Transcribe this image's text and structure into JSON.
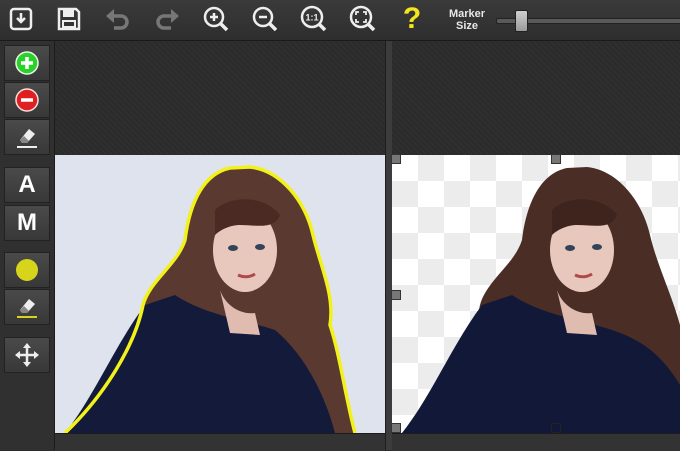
{
  "toolbar": {
    "open_icon": "download-icon",
    "save_icon": "floppy-disk-icon",
    "undo_icon": "undo-icon",
    "redo_icon": "redo-icon",
    "zoom_in_icon": "zoom-in-icon",
    "zoom_out_icon": "zoom-out-icon",
    "actual_size_label": "1:1",
    "fit_icon": "fit-screen-icon",
    "help_label": "?",
    "marker_size_line1": "Marker",
    "marker_size_line2": "Size",
    "marker_size_level": 0.12
  },
  "sidebar": {
    "add_icon": "plus-circle-icon",
    "remove_icon": "minus-circle-icon",
    "eraser_icon": "eraser-icon",
    "auto_label": "A",
    "manual_label": "M",
    "color_icon": "yellow-dot-icon",
    "eraser2_icon": "eraser-icon",
    "move_icon": "move-arrows-icon"
  },
  "colors": {
    "add": "#2bd12b",
    "remove": "#e02020",
    "marker": "#f2f21a",
    "help": "#f5e51b"
  }
}
